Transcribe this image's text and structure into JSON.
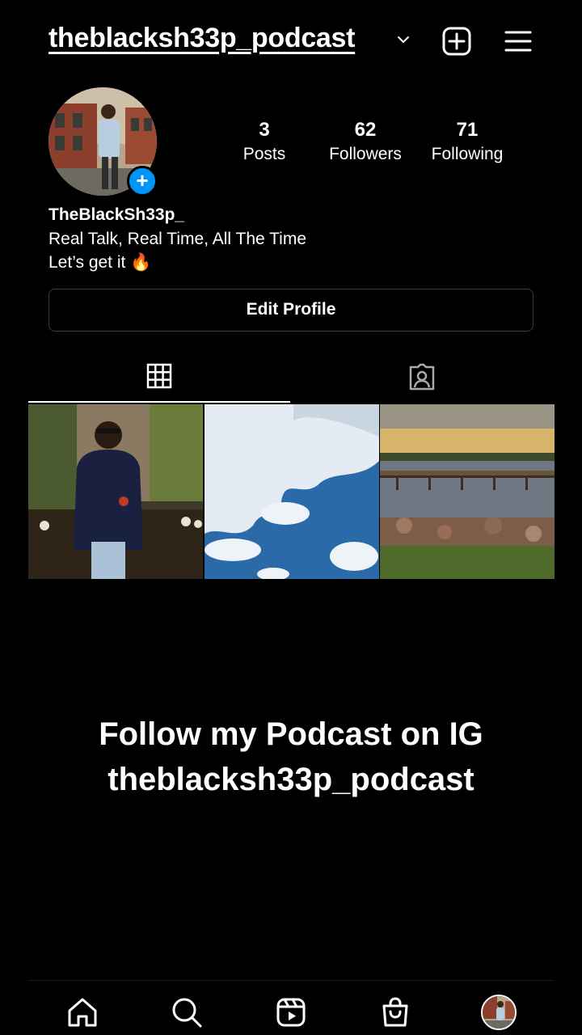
{
  "header": {
    "username": "theblacksh33p_podcast",
    "icons": [
      "chevron-down-icon",
      "new-post-icon",
      "menu-icon"
    ]
  },
  "profile": {
    "posts_count": "3",
    "posts_label": "Posts",
    "followers_count": "62",
    "followers_label": "Followers",
    "following_count": "71",
    "following_label": "Following",
    "display_name": "TheBlackSh33p_",
    "bio_line1": "Real Talk, Real Time, All The Time",
    "bio_line2": "Let’s get it 🔥",
    "add_story_symbol": "+"
  },
  "actions": {
    "edit_profile_label": "Edit Profile"
  },
  "tabs": [
    {
      "name": "grid",
      "icon": "grid-icon",
      "active": true
    },
    {
      "name": "tagged",
      "icon": "tagged-icon",
      "active": false
    }
  ],
  "posts": [
    {
      "subject": "man in navy sweater outdoors at night"
    },
    {
      "subject": "blue sky with clouds"
    },
    {
      "subject": "pier over lake at sunset with rocks"
    }
  ],
  "overlay": {
    "line1": "Follow my Podcast on IG",
    "line2": "theblacksh33p_podcast"
  },
  "bottom_nav": [
    "home-icon",
    "search-icon",
    "reels-icon",
    "shop-icon",
    "profile-avatar"
  ],
  "colors": {
    "background": "#000000",
    "accent_blue": "#0095f6",
    "border": "#3a3a3a"
  }
}
